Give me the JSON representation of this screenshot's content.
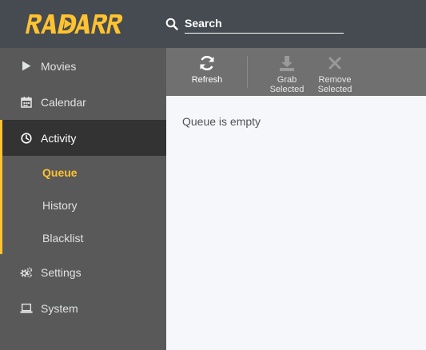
{
  "app": {
    "logo_text": "RADARR",
    "colors": {
      "header_bg": "#464b51",
      "sidebar_bg": "#595959",
      "accent": "#ffc230",
      "active_bg": "#333333",
      "toolbar_bg": "#707070",
      "content_bg": "#f5f7fa"
    }
  },
  "header": {
    "search": {
      "placeholder": "Search",
      "value": "",
      "icon": "search-icon"
    }
  },
  "sidebar": {
    "items": [
      {
        "label": "Movies",
        "icon": "play-icon"
      },
      {
        "label": "Calendar",
        "icon": "calendar-icon"
      },
      {
        "label": "Activity",
        "icon": "clock-icon",
        "active": true
      },
      {
        "label": "Settings",
        "icon": "gears-icon"
      },
      {
        "label": "System",
        "icon": "laptop-icon"
      }
    ],
    "activity_sub": [
      {
        "label": "Queue",
        "active": true
      },
      {
        "label": "History"
      },
      {
        "label": "Blacklist"
      }
    ]
  },
  "toolbar": {
    "refresh_label": "Refresh",
    "grab_line1": "Grab",
    "grab_line2": "Selected",
    "remove_line1": "Remove",
    "remove_line2": "Selected"
  },
  "content": {
    "empty_message": "Queue is empty"
  }
}
